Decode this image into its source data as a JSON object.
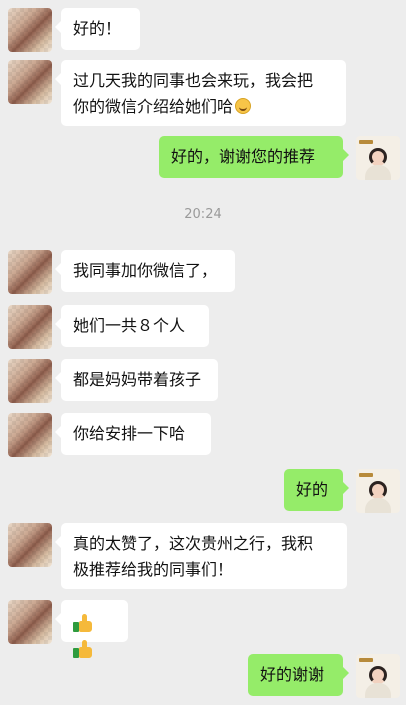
{
  "chat": {
    "timestamp": "20:24",
    "messages": [
      {
        "side": "left",
        "text": "好的！"
      },
      {
        "side": "left",
        "text_line1": "过几天我的同事也会来玩，我会把",
        "text_line2": "你的微信介绍给她们哈",
        "trailing_emoji": "smile-emoji"
      },
      {
        "side": "right",
        "text": "好的，谢谢您的推荐"
      },
      {
        "side": "left",
        "text": "我同事加你微信了，"
      },
      {
        "side": "left",
        "text": "她们一共８个人"
      },
      {
        "side": "left",
        "text": "都是妈妈带着孩子"
      },
      {
        "side": "left",
        "text": "你给安排一下哈"
      },
      {
        "side": "right",
        "text": "好的"
      },
      {
        "side": "left",
        "text_line1": "真的太赞了，这次贵州之行，我积",
        "text_line2": "极推荐给我的同事们！"
      },
      {
        "side": "left",
        "emoji": [
          "thumbs-up-emoji",
          "thumbs-up-emoji"
        ]
      },
      {
        "side": "right",
        "text": "好的谢谢"
      }
    ]
  },
  "colors": {
    "background": "#ededed",
    "incoming_bubble": "#ffffff",
    "outgoing_bubble": "#95ec69",
    "timestamp_text": "#9a9a9a"
  }
}
